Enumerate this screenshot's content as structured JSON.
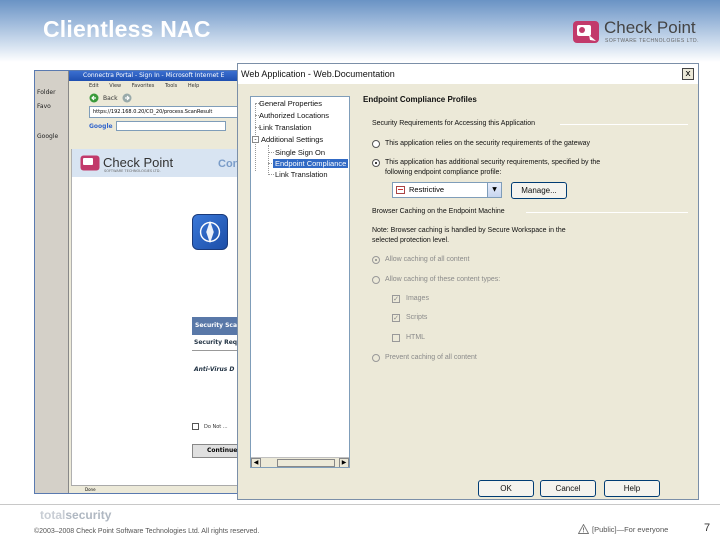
{
  "slide": {
    "title": "Clientless NAC",
    "brand": "Check Point",
    "brand_tag": "SOFTWARE TECHNOLOGIES LTD.",
    "page_number": "7",
    "footer_copyright": "©2003–2008 Check Point Software Technologies Ltd. All rights reserved.",
    "footer_classification": "[Public]—For everyone",
    "footer_brand_a": "total",
    "footer_brand_b": "security"
  },
  "browser": {
    "title": "Connectra Portal - Sign In - Microsoft Internet E",
    "menu": [
      "Edit",
      "View",
      "Favorites",
      "Tools",
      "Help"
    ],
    "back_label": "Back",
    "address": "https://192.168.0.20/CO_20/process.ScanResult",
    "google_label": "Google",
    "left_strip_labels": [
      "Folder",
      "Favo",
      "Google"
    ],
    "page_brand": "Check Point",
    "page_brand_tag": "SOFTWARE TECHNOLOGIES LTD.",
    "page_heading": "Conn",
    "security_box": "Security Sca",
    "security_req": "Security Req",
    "antivirus": "Anti-Virus D",
    "checkbox_label": "Do Not ...",
    "continue_label": "Continue",
    "status_left": "Done",
    "status_inner": "Done"
  },
  "dialog": {
    "title": "Web Application - Web.Documentation",
    "close_label": "x",
    "tree": [
      {
        "label": "General Properties",
        "selected": false
      },
      {
        "label": "Authorized Locations",
        "selected": false
      },
      {
        "label": "Link Translation",
        "selected": false
      },
      {
        "label": "Additional Settings",
        "selected": false
      },
      {
        "label": "Single Sign On",
        "selected": false
      },
      {
        "label": "Endpoint Compliance",
        "selected": true
      },
      {
        "label": "Link Translation",
        "selected": false
      }
    ],
    "section_title": "Endpoint Compliance Profiles",
    "group1": "Security Requirements for Accessing this Application",
    "radio1": "This application relies on the security requirements of the gateway",
    "radio2_line1": "This application has additional security requirements, specified by the",
    "radio2_line2": "following endpoint compliance profile:",
    "dropdown_value": "Restrictive",
    "manage_label": "Manage...",
    "group2": "Browser Caching on the Endpoint Machine",
    "note_line1": "Note: Browser caching is handled by Secure Workspace in the",
    "note_line2": "selected protection level.",
    "opt_allow_all": "Allow caching of all content",
    "opt_allow_types": "Allow caching of these content types:",
    "type_images": "Images",
    "type_scripts": "Scripts",
    "type_html": "HTML",
    "opt_prevent": "Prevent caching of all content",
    "ok_label": "OK",
    "cancel_label": "Cancel",
    "help_label": "Help"
  }
}
